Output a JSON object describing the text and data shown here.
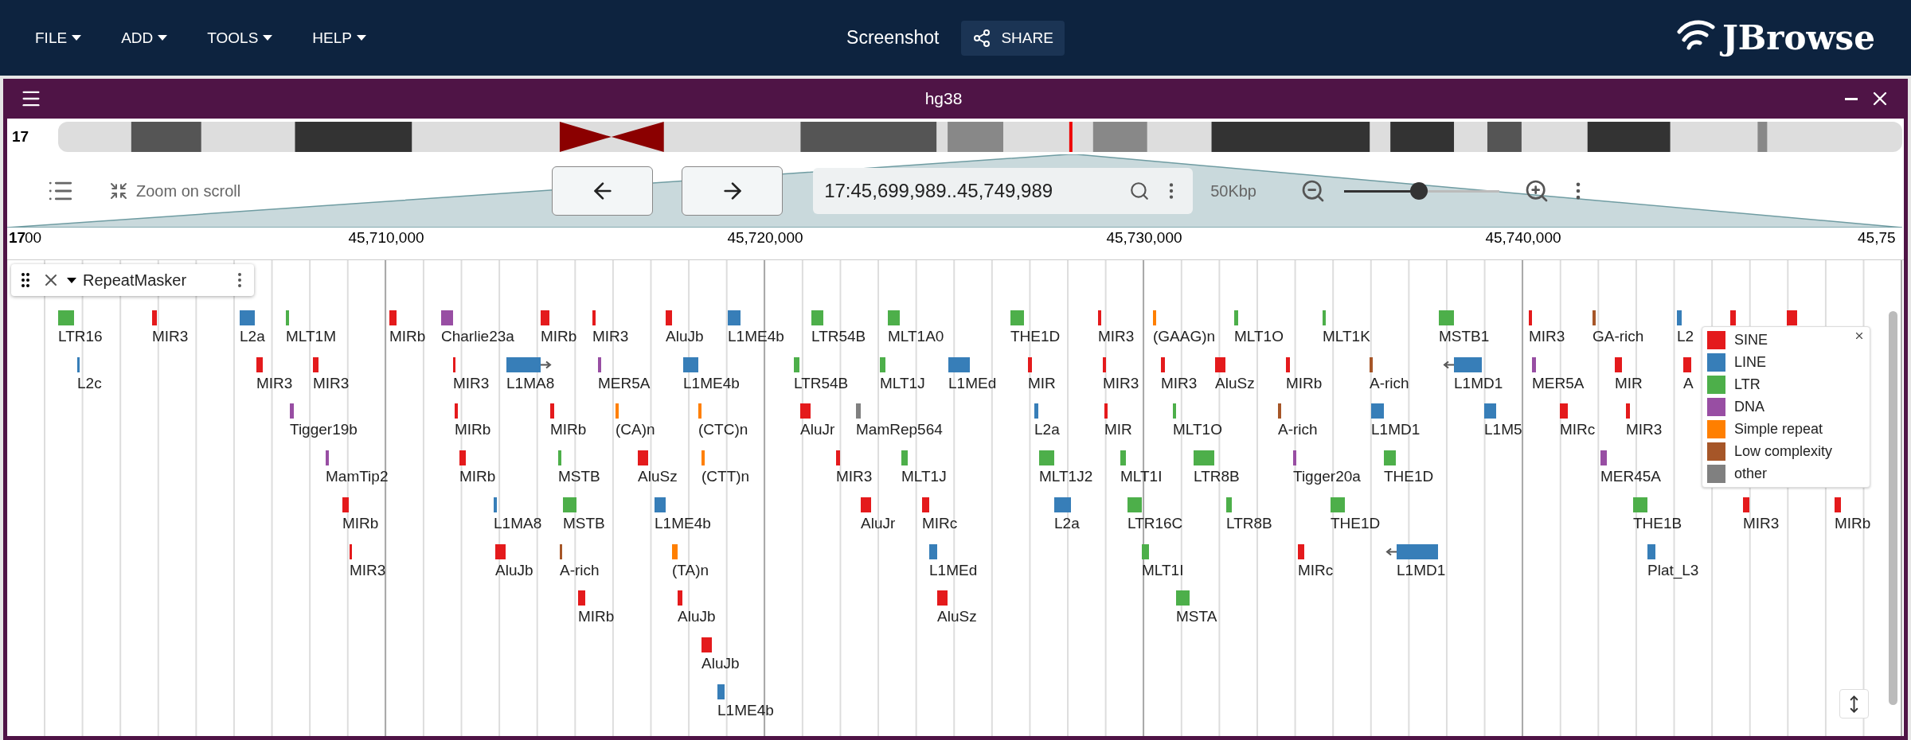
{
  "header": {
    "menu": [
      {
        "label": "FILE"
      },
      {
        "label": "ADD"
      },
      {
        "label": "TOOLS"
      },
      {
        "label": "HELP"
      }
    ],
    "session_title": "Screenshot",
    "share_button": "SHARE",
    "logo": "JBrowse"
  },
  "view": {
    "title": "hg38",
    "chromosome": "17",
    "zoom_on_scroll": "Zoom on scroll",
    "location": "17:45,699,989..45,749,989",
    "span": "50Kbp",
    "zoom": {
      "level": 0.48
    },
    "ruler": {
      "chromosome": "17",
      "cut_label": "00",
      "ticks": [
        "45,710,000",
        "45,720,000",
        "45,730,000",
        "45,740,000",
        "45,75"
      ]
    },
    "track": {
      "label": "RepeatMasker",
      "features": [
        {
          "name": "LTR16",
          "color": "#4daf4a",
          "kind": "block"
        },
        {
          "name": "MIR3",
          "color": "#e41a1c",
          "kind": "block"
        },
        {
          "name": "L2a",
          "color": "#377eb8",
          "kind": "block"
        },
        {
          "name": "MLT1M",
          "color": "#4daf4a",
          "kind": "block"
        },
        {
          "name": "MIRb",
          "color": "#e41a1c",
          "kind": "block"
        },
        {
          "name": "Charlie23a",
          "color": "#984ea3",
          "kind": "block"
        },
        {
          "name": "MIRb",
          "color": "#e41a1c",
          "kind": "block"
        },
        {
          "name": "MIR3",
          "color": "#e41a1c",
          "kind": "block"
        },
        {
          "name": "AluJb",
          "color": "#e41a1c",
          "kind": "block"
        },
        {
          "name": "L1ME4b",
          "color": "#377eb8",
          "kind": "block"
        },
        {
          "name": "LTR54B",
          "color": "#4daf4a",
          "kind": "block"
        },
        {
          "name": "MLT1A0",
          "color": "#4daf4a",
          "kind": "block"
        },
        {
          "name": "THE1D",
          "color": "#4daf4a",
          "kind": "block"
        },
        {
          "name": "MIR3",
          "color": "#e41a1c",
          "kind": "block"
        },
        {
          "name": "(GAAG)n",
          "color": "#ff7f00",
          "kind": "block"
        },
        {
          "name": "MLT1O",
          "color": "#4daf4a",
          "kind": "block"
        },
        {
          "name": "MLT1K",
          "color": "#4daf4a",
          "kind": "block"
        },
        {
          "name": "MSTB1",
          "color": "#4daf4a",
          "kind": "block"
        },
        {
          "name": "MIR3",
          "color": "#e41a1c",
          "kind": "block"
        },
        {
          "name": "GA-rich",
          "color": "#a65628",
          "kind": "block"
        },
        {
          "name": "L2",
          "color": "#377eb8",
          "kind": "block"
        },
        {
          "color": "#e41a1c",
          "kind": "block"
        },
        {
          "color": "#e41a1c",
          "kind": "block"
        },
        {
          "name": "L2c",
          "color": "#377eb8",
          "kind": "block"
        },
        {
          "name": "MIR3",
          "color": "#e41a1c",
          "kind": "block"
        },
        {
          "name": "MIR3",
          "color": "#e41a1c",
          "kind": "block"
        },
        {
          "name": "MIR3",
          "color": "#e41a1c",
          "kind": "block"
        },
        {
          "name": "L1MA8",
          "color": "#377eb8",
          "kind": "arrow_right"
        },
        {
          "name": "MER5A",
          "color": "#984ea3",
          "kind": "block"
        },
        {
          "name": "L1ME4b",
          "color": "#377eb8",
          "kind": "block"
        },
        {
          "name": "LTR54B",
          "color": "#4daf4a",
          "kind": "block"
        },
        {
          "name": "MLT1J",
          "color": "#4daf4a",
          "kind": "block"
        },
        {
          "name": "L1MEd",
          "color": "#377eb8",
          "kind": "block"
        },
        {
          "name": "MIR",
          "color": "#e41a1c",
          "kind": "block"
        },
        {
          "name": "MIR3",
          "color": "#e41a1c",
          "kind": "block"
        },
        {
          "name": "MIR3",
          "color": "#e41a1c",
          "kind": "block"
        },
        {
          "name": "AluSz",
          "color": "#e41a1c",
          "kind": "block"
        },
        {
          "name": "MIRb",
          "color": "#e41a1c",
          "kind": "block"
        },
        {
          "name": "A-rich",
          "color": "#a65628",
          "kind": "block"
        },
        {
          "name": "L1MD1",
          "color": "#377eb8",
          "kind": "arrow_left"
        },
        {
          "name": "MER5A",
          "color": "#984ea3",
          "kind": "block"
        },
        {
          "name": "MIR",
          "color": "#e41a1c",
          "kind": "block"
        },
        {
          "name": "A",
          "color": "#e41a1c",
          "kind": "block"
        },
        {
          "name": "Tigger19b",
          "color": "#984ea3",
          "kind": "block"
        },
        {
          "name": "MIRb",
          "color": "#e41a1c",
          "kind": "block"
        },
        {
          "name": "MIRb",
          "color": "#e41a1c",
          "kind": "block"
        },
        {
          "name": "(CA)n",
          "color": "#ff7f00",
          "kind": "block"
        },
        {
          "name": "(CTC)n",
          "color": "#ff7f00",
          "kind": "block"
        },
        {
          "name": "AluJr",
          "color": "#e41a1c",
          "kind": "block"
        },
        {
          "name": "MamRep564",
          "color": "#808080",
          "kind": "block"
        },
        {
          "name": "L2a",
          "color": "#377eb8",
          "kind": "block"
        },
        {
          "name": "MIR",
          "color": "#e41a1c",
          "kind": "block"
        },
        {
          "name": "MLT1O",
          "color": "#4daf4a",
          "kind": "block"
        },
        {
          "name": "A-rich",
          "color": "#a65628",
          "kind": "block"
        },
        {
          "name": "L1MD1",
          "color": "#377eb8",
          "kind": "block"
        },
        {
          "name": "L1M5",
          "color": "#377eb8",
          "kind": "block"
        },
        {
          "name": "MIRc",
          "color": "#e41a1c",
          "kind": "block"
        },
        {
          "name": "MIR3",
          "color": "#e41a1c",
          "kind": "block"
        },
        {
          "name": "MamTip2",
          "color": "#984ea3",
          "kind": "block"
        },
        {
          "name": "MIRb",
          "color": "#e41a1c",
          "kind": "block"
        },
        {
          "name": "MSTB",
          "color": "#4daf4a",
          "kind": "block"
        },
        {
          "name": "AluSz",
          "color": "#e41a1c",
          "kind": "block"
        },
        {
          "name": "(CTT)n",
          "color": "#ff7f00",
          "kind": "block"
        },
        {
          "name": "MIR3",
          "color": "#e41a1c",
          "kind": "block"
        },
        {
          "name": "MLT1J",
          "color": "#4daf4a",
          "kind": "block"
        },
        {
          "name": "MLT1J2",
          "color": "#4daf4a",
          "kind": "block"
        },
        {
          "name": "MLT1I",
          "color": "#4daf4a",
          "kind": "block"
        },
        {
          "name": "LTR8B",
          "color": "#4daf4a",
          "kind": "block"
        },
        {
          "name": "Tigger20a",
          "color": "#984ea3",
          "kind": "block"
        },
        {
          "name": "THE1D",
          "color": "#4daf4a",
          "kind": "block"
        },
        {
          "name": "MER45A",
          "color": "#984ea3",
          "kind": "block"
        },
        {
          "name": "MIRb",
          "color": "#e41a1c",
          "kind": "block"
        },
        {
          "name": "L1MA8",
          "color": "#377eb8",
          "kind": "block"
        },
        {
          "name": "MSTB",
          "color": "#4daf4a",
          "kind": "block"
        },
        {
          "name": "L1ME4b",
          "color": "#377eb8",
          "kind": "block"
        },
        {
          "name": "AluJr",
          "color": "#e41a1c",
          "kind": "block"
        },
        {
          "name": "MIRc",
          "color": "#e41a1c",
          "kind": "block"
        },
        {
          "name": "L2a",
          "color": "#377eb8",
          "kind": "block"
        },
        {
          "name": "LTR16C",
          "color": "#4daf4a",
          "kind": "block"
        },
        {
          "name": "LTR8B",
          "color": "#4daf4a",
          "kind": "block"
        },
        {
          "name": "THE1D",
          "color": "#4daf4a",
          "kind": "block"
        },
        {
          "name": "THE1B",
          "color": "#4daf4a",
          "kind": "block"
        },
        {
          "name": "MIR3",
          "color": "#e41a1c",
          "kind": "block"
        },
        {
          "name": "MIRb",
          "color": "#e41a1c",
          "kind": "block"
        },
        {
          "name": "MIR3",
          "color": "#e41a1c",
          "kind": "block"
        },
        {
          "name": "AluJb",
          "color": "#e41a1c",
          "kind": "block"
        },
        {
          "name": "A-rich",
          "color": "#a65628",
          "kind": "block"
        },
        {
          "name": "(TA)n",
          "color": "#ff7f00",
          "kind": "block"
        },
        {
          "name": "L1MEd",
          "color": "#377eb8",
          "kind": "block"
        },
        {
          "name": "MLT1I",
          "color": "#4daf4a",
          "kind": "block"
        },
        {
          "name": "MIRc",
          "color": "#e41a1c",
          "kind": "block"
        },
        {
          "name": "L1MD1",
          "color": "#377eb8",
          "kind": "arrow_left"
        },
        {
          "name": "Plat_L3",
          "color": "#377eb8",
          "kind": "block"
        },
        {
          "name": "MIRb",
          "color": "#e41a1c",
          "kind": "block"
        },
        {
          "name": "AluJb",
          "color": "#e41a1c",
          "kind": "block"
        },
        {
          "name": "AluSz",
          "color": "#e41a1c",
          "kind": "block"
        },
        {
          "name": "MSTA",
          "color": "#4daf4a",
          "kind": "block"
        },
        {
          "name": "AluJb",
          "color": "#e41a1c",
          "kind": "block"
        },
        {
          "name": "L1ME4b",
          "color": "#377eb8",
          "kind": "block"
        }
      ]
    },
    "legend": {
      "items": [
        {
          "label": "SINE",
          "color": "#e41a1c"
        },
        {
          "label": "LINE",
          "color": "#377eb8"
        },
        {
          "label": "LTR",
          "color": "#4daf4a"
        },
        {
          "label": "DNA",
          "color": "#984ea3"
        },
        {
          "label": "Simple repeat",
          "color": "#ff7f00"
        },
        {
          "label": "Low complexity",
          "color": "#a65628"
        },
        {
          "label": "other",
          "color": "#808080"
        }
      ]
    }
  }
}
